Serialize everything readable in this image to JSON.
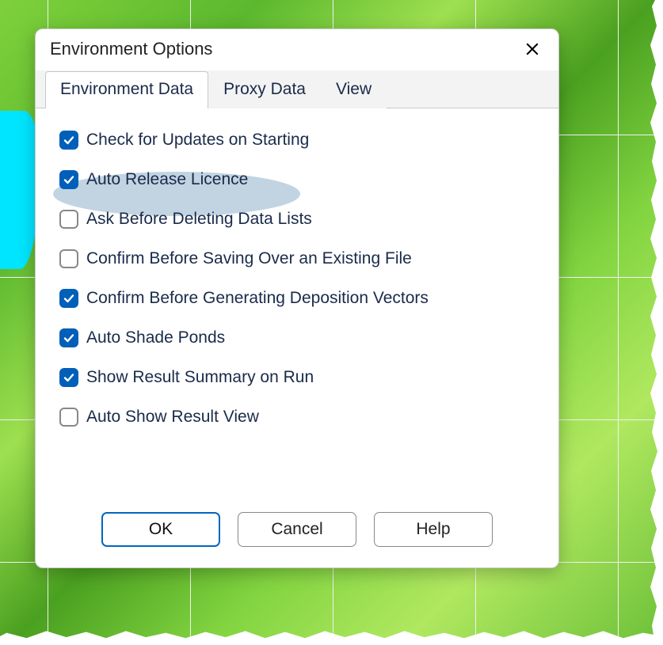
{
  "dialog": {
    "title": "Environment Options"
  },
  "tabs": [
    {
      "label": "Environment Data",
      "active": true
    },
    {
      "label": "Proxy Data",
      "active": false
    },
    {
      "label": "View",
      "active": false
    }
  ],
  "options": [
    {
      "label": "Check for Updates on Starting",
      "checked": true
    },
    {
      "label": "Auto Release Licence",
      "checked": true,
      "highlighted": true
    },
    {
      "label": "Ask Before Deleting Data Lists",
      "checked": false
    },
    {
      "label": "Confirm Before Saving Over an Existing File",
      "checked": false
    },
    {
      "label": "Confirm Before Generating Deposition Vectors",
      "checked": true
    },
    {
      "label": "Auto Shade Ponds",
      "checked": true
    },
    {
      "label": "Show Result Summary on Run",
      "checked": true
    },
    {
      "label": "Auto Show Result View",
      "checked": false
    }
  ],
  "buttons": {
    "ok": "OK",
    "cancel": "Cancel",
    "help": "Help"
  }
}
